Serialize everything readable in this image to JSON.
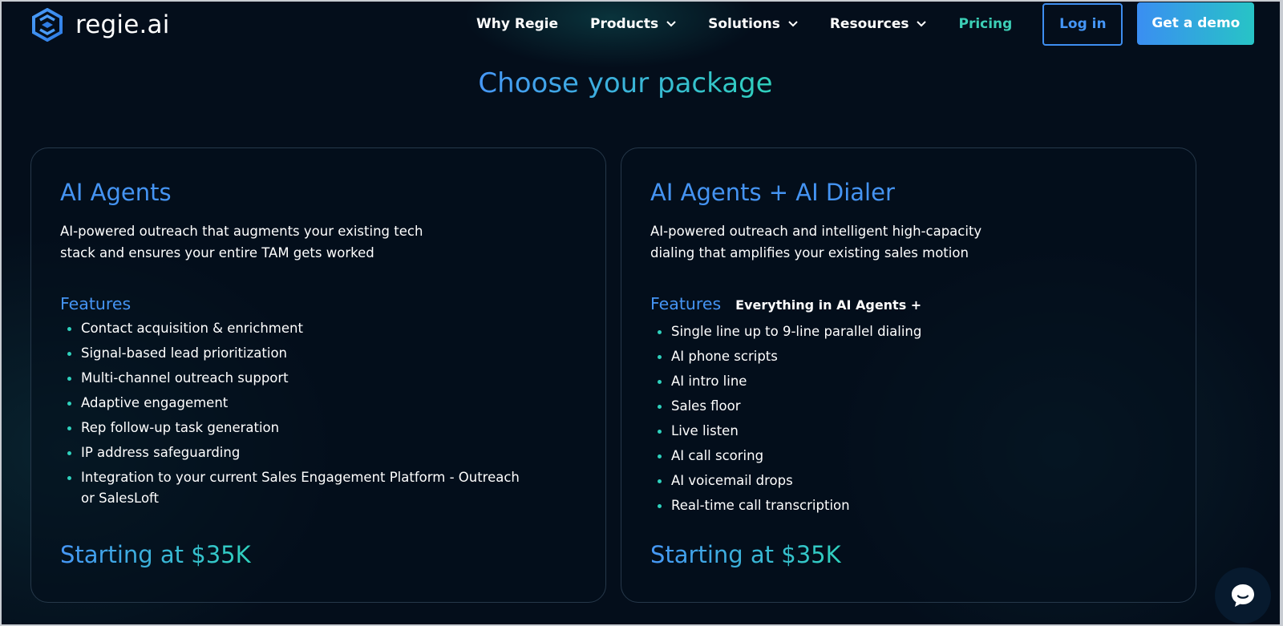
{
  "header": {
    "logo_text": "regie.ai",
    "nav": [
      {
        "label": "Why Regie",
        "dropdown": false
      },
      {
        "label": "Products",
        "dropdown": true
      },
      {
        "label": "Solutions",
        "dropdown": true
      },
      {
        "label": "Resources",
        "dropdown": true
      },
      {
        "label": "Pricing",
        "dropdown": false,
        "active": true
      }
    ],
    "login_label": "Log in",
    "demo_label": "Get a demo"
  },
  "page": {
    "title": "Choose your package"
  },
  "cards": [
    {
      "title": "AI Agents",
      "description": "AI-powered outreach that augments your existing tech stack and ensures your entire TAM gets worked",
      "features_label": "Features",
      "features_extra": "",
      "features": [
        "Contact acquisition & enrichment",
        "Signal-based lead prioritization",
        "Multi-channel outreach support",
        "Adaptive engagement",
        "Rep follow-up task generation",
        "IP address safeguarding",
        "Integration to your current Sales Engagement Platform - Outreach or SalesLoft"
      ],
      "price": "Starting at $35K"
    },
    {
      "title": "AI Agents + AI Dialer",
      "description": "AI-powered outreach and intelligent high-capacity dialing that amplifies your existing sales motion",
      "features_label": "Features",
      "features_extra": "Everything in AI Agents +",
      "features": [
        "Single line up to 9-line parallel dialing",
        "AI phone scripts",
        "AI intro line",
        "Sales floor",
        "Live listen",
        "AI call scoring",
        "AI voicemail drops",
        "Real-time call transcription"
      ],
      "price": "Starting at $35K"
    }
  ],
  "colors": {
    "background": "#040e1b",
    "accent_blue": "#4594f3",
    "accent_teal": "#2fd1bd",
    "text": "#ffffff"
  },
  "icons": {
    "logo": "regie-hexagon-logo-icon",
    "dropdown": "chevron-down-icon",
    "chat": "chat-bubble-icon"
  }
}
